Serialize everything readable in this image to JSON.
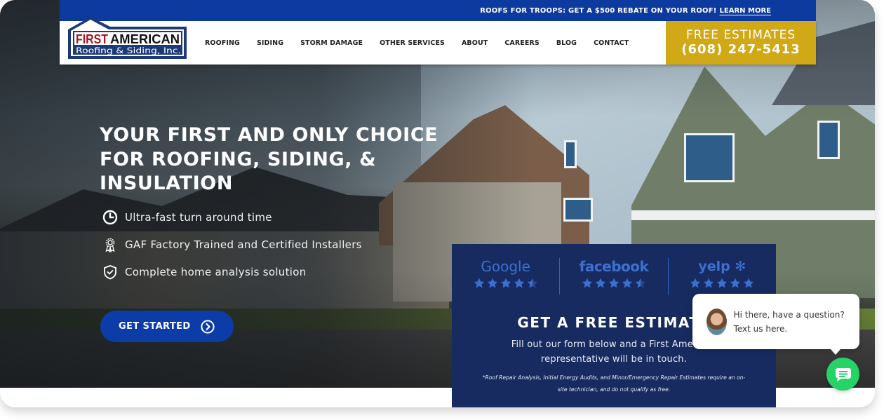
{
  "promo": {
    "text": "ROOFS FOR TROOPS: GET A $500 REBATE ON YOUR ROOF!",
    "link_label": "LEARN MORE"
  },
  "logo": {
    "line1_red": "FIRST",
    "line1_black": "AMERICAN",
    "line2": "Roofing & Siding, Inc."
  },
  "nav": {
    "items": [
      {
        "label": "ROOFING"
      },
      {
        "label": "SIDING"
      },
      {
        "label": "STORM DAMAGE"
      },
      {
        "label": "OTHER SERVICES"
      },
      {
        "label": "ABOUT"
      },
      {
        "label": "CAREERS"
      },
      {
        "label": "BLOG"
      },
      {
        "label": "CONTACT"
      }
    ]
  },
  "cta": {
    "label": "FREE ESTIMATES",
    "phone": "(608) 247-5413"
  },
  "hero": {
    "headline_lines": [
      "YOUR FIRST AND ONLY CHOICE",
      "FOR ROOFING, SIDING, &",
      "INSULATION"
    ],
    "features": [
      {
        "icon": "clock-icon",
        "text": "Ultra-fast turn around time"
      },
      {
        "icon": "award-ribbon-icon",
        "text": "GAF Factory Trained and Certified Installers"
      },
      {
        "icon": "shield-check-icon",
        "text": "Complete home analysis solution"
      }
    ],
    "button_label": "GET STARTED"
  },
  "reviews": [
    {
      "brand": "Google",
      "rating": 4.5
    },
    {
      "brand": "facebook",
      "rating": 4.5
    },
    {
      "brand": "yelp",
      "rating": 5
    }
  ],
  "estimate": {
    "title": "GET A FREE ESTIMATE",
    "body": "Fill out our form below and a First American representative will be in touch.",
    "note": "*Roof Repair Analysis, Initial Energy Audits, and Minor/Emergency Repair Estimates require an on-site technician, and do not qualify as free."
  },
  "chat": {
    "message": "Hi there, have a question? Text us here."
  },
  "colors": {
    "brand_blue": "#0d3a9e",
    "gold": "#d1a816",
    "panel_navy": "#172b61",
    "star_blue": "#3d6fd1",
    "chat_green": "#26d366",
    "logo_red": "#a3171d"
  }
}
